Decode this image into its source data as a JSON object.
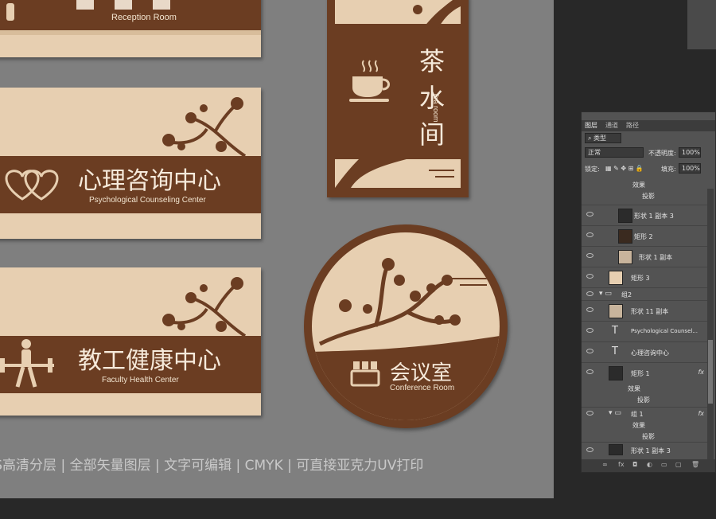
{
  "colors": {
    "brown": "#6b3d22",
    "cream": "#e7cfb1",
    "canvas": "#7f7f7f"
  },
  "signs": {
    "reception": {
      "en": "Reception Room"
    },
    "psych": {
      "cn": "心理咨询中心",
      "en": "Psychological Counseling Center"
    },
    "health": {
      "cn": "教工健康中心",
      "en": "Faculty Health Center"
    },
    "tea": {
      "cn1": "茶",
      "cn2": "水",
      "cn3": "间",
      "en": "Tea room"
    },
    "conference": {
      "cn": "会议室",
      "en": "Conference Room"
    }
  },
  "footer": "PS高清分层 | 全部矢量图层 | 文字可编辑 | CMYK | 可直接亚克力UV打印",
  "panel": {
    "tabs": [
      "图层",
      "通道",
      "路径"
    ],
    "kind_label": "类型",
    "blend_mode": "正常",
    "opacity_label": "不透明度:",
    "opacity_value": "100%",
    "lock_label": "锁定:",
    "fill_label": "填充:",
    "fill_value": "100%",
    "layers": [
      {
        "name": "效果",
        "type": "effect-group"
      },
      {
        "name": "投影",
        "type": "effect"
      },
      {
        "name": "形状 1 副本 3",
        "type": "shape"
      },
      {
        "name": "矩形 2",
        "type": "shape"
      },
      {
        "name": "形状 1 副本",
        "type": "shape"
      },
      {
        "name": "矩形 3",
        "type": "shape"
      },
      {
        "name": "组2",
        "type": "group"
      },
      {
        "name": "形状 11 副本",
        "type": "shape"
      },
      {
        "name": "Psychological Counsel...",
        "type": "text"
      },
      {
        "name": "心理咨询中心",
        "type": "text"
      },
      {
        "name": "矩形 1",
        "type": "shape",
        "fx": "fx"
      },
      {
        "name": "效果",
        "type": "effect-group"
      },
      {
        "name": "投影",
        "type": "effect"
      },
      {
        "name": "组 1",
        "type": "group",
        "fx": "fx"
      },
      {
        "name": "效果",
        "type": "effect-group"
      },
      {
        "name": "投影",
        "type": "effect"
      },
      {
        "name": "形状 1 副本 3",
        "type": "shape"
      }
    ]
  }
}
